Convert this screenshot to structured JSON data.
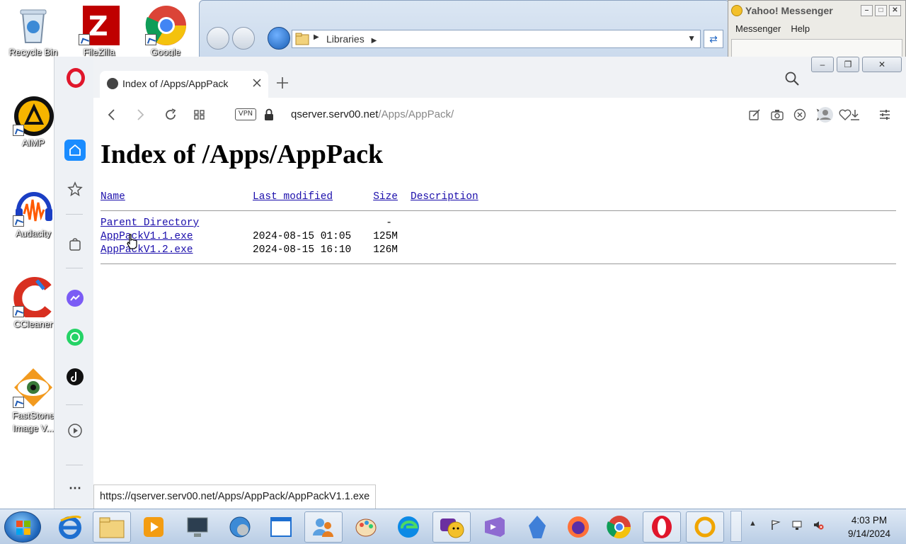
{
  "desktop": {
    "icons": [
      {
        "label": "Recycle Bin"
      },
      {
        "label": "FileZilla"
      },
      {
        "label": "Google"
      },
      {
        "label": "AIMP"
      },
      {
        "label": "Audacity"
      },
      {
        "label": "CCleaner"
      },
      {
        "label": "FastStone Image V..."
      }
    ]
  },
  "explorer": {
    "address": "Libraries"
  },
  "yahoo": {
    "title": "Yahoo! Messenger",
    "menu": [
      "Messenger",
      "Help"
    ]
  },
  "browser": {
    "tab_title": "Index of /Apps/AppPack",
    "vpn_label": "VPN",
    "url_host": "qserver.serv00.net",
    "url_path": "/Apps/AppPack/",
    "status_url": "https://qserver.serv00.net/Apps/AppPack/AppPackV1.1.exe"
  },
  "page": {
    "heading": "Index of /Apps/AppPack",
    "columns": {
      "name": "Name",
      "modified": "Last modified",
      "size": "Size",
      "description": "Description"
    },
    "parent": {
      "name": "Parent Directory",
      "size": "-"
    },
    "files": [
      {
        "name": "AppPackV1.1.exe",
        "modified": "2024-08-15 01:05",
        "size": "125M"
      },
      {
        "name": "AppPackV1.2.exe",
        "modified": "2024-08-15 16:10",
        "size": "126M"
      }
    ]
  },
  "taskbar": {
    "time": "4:03 PM",
    "date": "9/14/2024"
  }
}
